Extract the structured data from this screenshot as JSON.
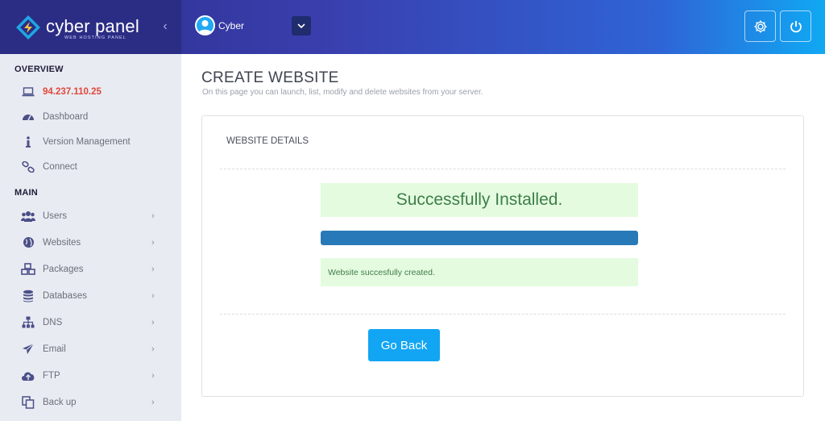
{
  "brand": {
    "name": "cyber panel",
    "tagline": "WEB HOSTING PANEL"
  },
  "header": {
    "user_name": "Cyber"
  },
  "sidebar": {
    "overview_label": "OVERVIEW",
    "main_label": "MAIN",
    "overview_items": [
      {
        "label": "94.237.110.25",
        "icon": "laptop-icon"
      },
      {
        "label": "Dashboard",
        "icon": "dashboard-icon"
      },
      {
        "label": "Version Management",
        "icon": "info-icon"
      },
      {
        "label": "Connect",
        "icon": "link-icon"
      }
    ],
    "main_items": [
      {
        "label": "Users",
        "icon": "users-icon"
      },
      {
        "label": "Websites",
        "icon": "globe-icon"
      },
      {
        "label": "Packages",
        "icon": "cubes-icon"
      },
      {
        "label": "Databases",
        "icon": "database-icon"
      },
      {
        "label": "DNS",
        "icon": "sitemap-icon"
      },
      {
        "label": "Email",
        "icon": "paper-plane-icon"
      },
      {
        "label": "FTP",
        "icon": "cloud-upload-icon"
      },
      {
        "label": "Back up",
        "icon": "copy-icon"
      }
    ]
  },
  "page": {
    "title": "CREATE WEBSITE",
    "subtitle": "On this page you can launch, list, modify and delete websites from your server."
  },
  "card": {
    "title": "WEBSITE DETAILS",
    "success_text": "Successfully Installed.",
    "progress_percent": 100,
    "message": "Website succesfully created.",
    "go_back_label": "Go Back"
  },
  "colors": {
    "accent": "#12a5f4",
    "progress": "#2879b7",
    "success_bg": "#e4fbe0",
    "ip_text": "#e0483b"
  }
}
